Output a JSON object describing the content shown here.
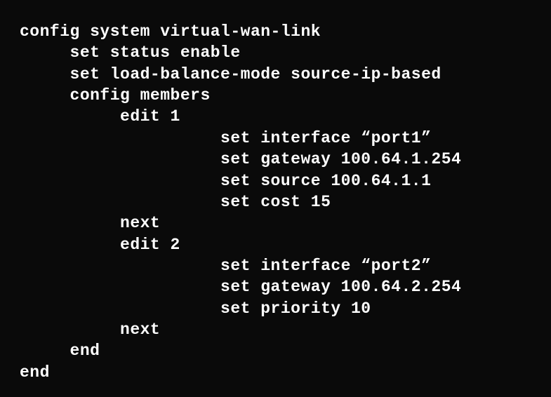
{
  "lines": {
    "l1": "config system virtual-wan-link",
    "l2": "     set status enable",
    "l3": "     set load-balance-mode source-ip-based",
    "l4": "     config members",
    "l5": "          edit 1",
    "l6": "                    set interface “port1”",
    "l7": "                    set gateway 100.64.1.254",
    "l8": "                    set source 100.64.1.1",
    "l9": "                    set cost 15",
    "l10": "          next",
    "l11": "          edit 2",
    "l12": "                    set interface “port2”",
    "l13": "                    set gateway 100.64.2.254",
    "l14": "                    set priority 10",
    "l15": "          next",
    "l16": "     end",
    "l17": "end"
  }
}
